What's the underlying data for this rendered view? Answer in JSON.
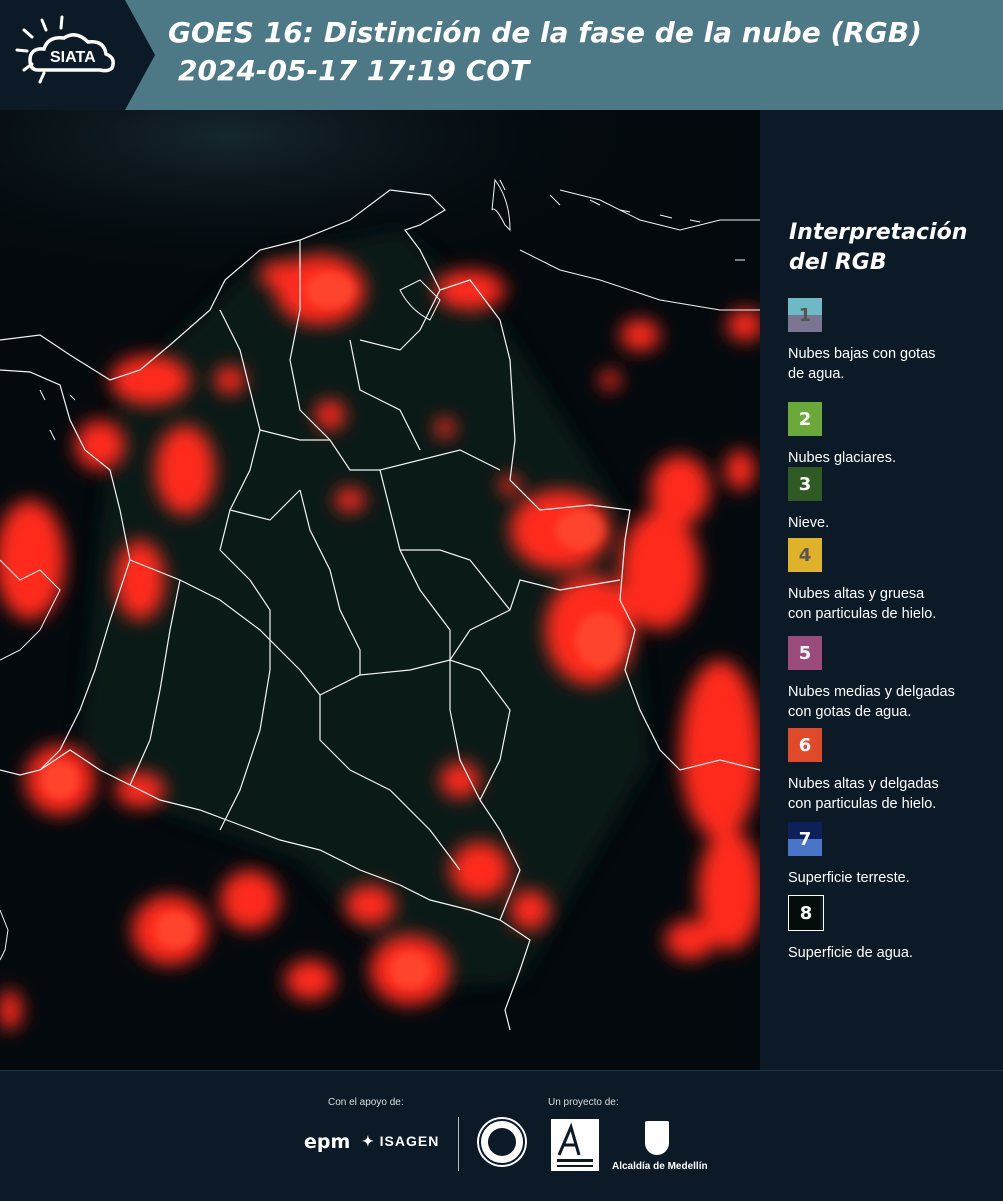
{
  "header": {
    "logo_text": "SIATA",
    "title_line1": "GOES 16: Distinción de la fase de la nube (RGB)",
    "title_line2": "2024-05-17 17:19 COT"
  },
  "legend": {
    "title_line1": "Interpretación",
    "title_line2": "del RGB",
    "items": [
      {
        "number": "1",
        "label_line1": "Nubes bajas con gotas",
        "label_line2": "de agua.",
        "color_top": "#6fb8c6",
        "color_bottom": "#7a7590",
        "num_color": "#555"
      },
      {
        "number": "2",
        "label_line1": "Nubes glaciares.",
        "label_line2": "",
        "color_top": "#6aa83a",
        "color_bottom": "#6aa83a",
        "num_color": "#fff"
      },
      {
        "number": "3",
        "label_line1": "Nieve.",
        "label_line2": "",
        "color_top": "#2f5a24",
        "color_bottom": "#2f5a24",
        "num_color": "#fff"
      },
      {
        "number": "4",
        "label_line1": "Nubes altas y gruesa",
        "label_line2": "con particulas de hielo.",
        "color_top": "#e0b22a",
        "color_bottom": "#e0b22a",
        "num_color": "#555"
      },
      {
        "number": "5",
        "label_line1": "Nubes medias y delgadas",
        "label_line2": "con gotas de agua.",
        "color_top": "#9b4a7c",
        "color_bottom": "#9b4a7c",
        "num_color": "#fff"
      },
      {
        "number": "6",
        "label_line1": "Nubes altas y delgadas",
        "label_line2": "con particulas de hielo.",
        "color_top": "#e04a2a",
        "color_bottom": "#e04a2a",
        "num_color": "#fff"
      },
      {
        "number": "7",
        "label_line1": "Superficie terreste.",
        "label_line2": "",
        "color_top": "#0f1f5a",
        "color_bottom": "#4a74c8",
        "num_color": "#fff"
      },
      {
        "number": "8",
        "label_line1": "Superficie de agua.",
        "label_line2": "",
        "color_top": "#050d0a",
        "color_bottom": "#050d0a",
        "num_color": "#fff"
      }
    ]
  },
  "footer": {
    "support_label": "Con el apoyo de:",
    "project_label": "Un proyecto de:",
    "epm": "epm",
    "isagen": "ISAGEN",
    "alcaldia": "Alcaldía de Medellín"
  },
  "colors": {
    "header_bg": "#4d7886",
    "logo_bg": "#0b1a26",
    "panel_bg": "#0b1a26",
    "cloud_red": "#ff2a1a"
  }
}
